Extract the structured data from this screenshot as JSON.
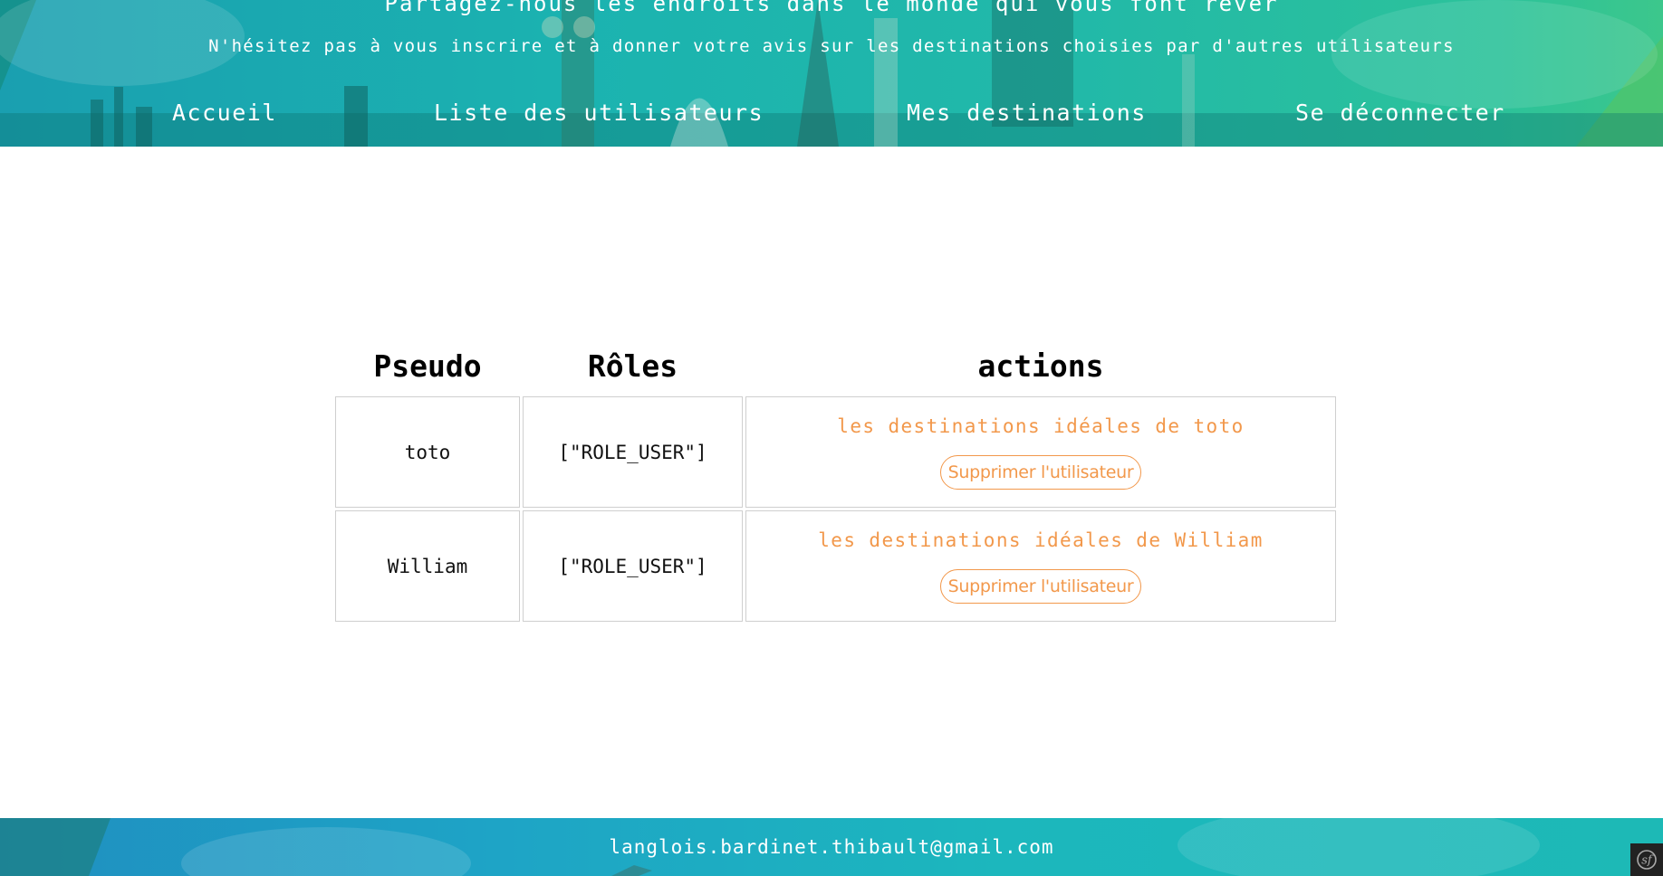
{
  "header": {
    "title": "Partagez-nous les endroits dans le monde qui vous font rêver",
    "subtitle": "N'hésitez pas à vous inscrire et à donner votre avis sur les destinations choisies par d'autres utilisateurs",
    "nav": [
      {
        "label": "Accueil"
      },
      {
        "label": "Liste des utilisateurs"
      },
      {
        "label": "Mes destinations"
      },
      {
        "label": "Se déconnecter"
      }
    ]
  },
  "table": {
    "headers": {
      "pseudo": "Pseudo",
      "roles": "Rôles",
      "actions": "actions"
    },
    "rows": [
      {
        "pseudo": "toto",
        "roles": "[\"ROLE_USER\"]",
        "destinations_link": "les destinations idéales de toto",
        "delete_label": "Supprimer l'utilisateur"
      },
      {
        "pseudo": "William",
        "roles": "[\"ROLE_USER\"]",
        "destinations_link": "les destinations idéales de William",
        "delete_label": "Supprimer l'utilisateur"
      }
    ]
  },
  "footer": {
    "email": "langlois.bardinet.thibault@gmail.com"
  },
  "toolbar": {
    "icon": "symfony-icon"
  },
  "colors": {
    "accent": "#f2984b",
    "header_teal": "#1bb3b0",
    "header_green": "#3cc78c",
    "footer_blue": "#1f8fc0"
  }
}
